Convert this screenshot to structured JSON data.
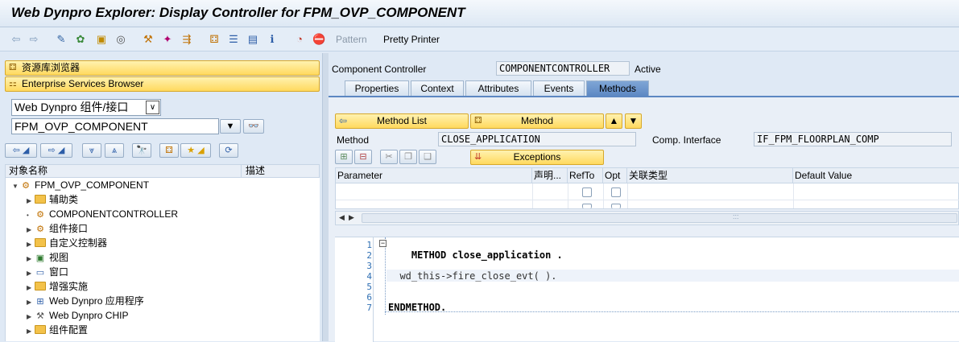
{
  "window": {
    "title": "Web Dynpro Explorer: Display Controller for FPM_OVP_COMPONENT"
  },
  "toolbar": {
    "pattern_label": "Pattern",
    "pretty_printer_label": "Pretty Printer"
  },
  "left": {
    "repo_browser_label": "资源库浏览器",
    "es_browser_label": "Enterprise Services Browser",
    "object_type_value": "Web Dynpro 组件/接口",
    "object_name_value": "FPM_OVP_COMPONENT",
    "tree_col_name": "对象名称",
    "tree_col_desc": "描述",
    "tree": [
      {
        "label": "FPM_OVP_COMPONENT",
        "kind": "component"
      },
      {
        "label": "辅助类",
        "kind": "folder"
      },
      {
        "label": "COMPONENTCONTROLLER",
        "kind": "controller"
      },
      {
        "label": "组件接口",
        "kind": "interface"
      },
      {
        "label": "自定义控制器",
        "kind": "folder"
      },
      {
        "label": "视图",
        "kind": "view"
      },
      {
        "label": "窗口",
        "kind": "window"
      },
      {
        "label": "增强实施",
        "kind": "folder"
      },
      {
        "label": "Web Dynpro 应用程序",
        "kind": "application"
      },
      {
        "label": "Web Dynpro CHIP",
        "kind": "chip"
      },
      {
        "label": "组件配置",
        "kind": "folder"
      }
    ]
  },
  "right": {
    "component_controller_label": "Component Controller",
    "component_controller_value": "COMPONENTCONTROLLER",
    "status": "Active",
    "tabs": [
      "Properties",
      "Context",
      "Attributes",
      "Events",
      "Methods"
    ],
    "active_tab": "Methods",
    "method_list_btn": "Method List",
    "method_btn": "Method",
    "method_label": "Method",
    "method_value": "CLOSE_APPLICATION",
    "comp_interface_label": "Comp. Interface",
    "comp_interface_value": "IF_FPM_FLOORPLAN_COMP",
    "exceptions_btn": "Exceptions",
    "grid_headers": [
      "Parameter",
      "声明...",
      "RefTo",
      "Opt",
      "关联类型",
      "Default Value"
    ],
    "code_lines": [
      {
        "num": "1",
        "text": "METHOD close_application ."
      },
      {
        "num": "2",
        "text": ""
      },
      {
        "num": "3",
        "text": ""
      },
      {
        "num": "4",
        "text": "  wd_this->fire_close_evt( )."
      },
      {
        "num": "5",
        "text": ""
      },
      {
        "num": "6",
        "text": ""
      },
      {
        "num": "7",
        "text": "ENDMETHOD."
      }
    ]
  },
  "colors": {
    "accent": "#5c87c2",
    "button_yellow": "#ffd95e",
    "background": "#dfe9f5"
  }
}
